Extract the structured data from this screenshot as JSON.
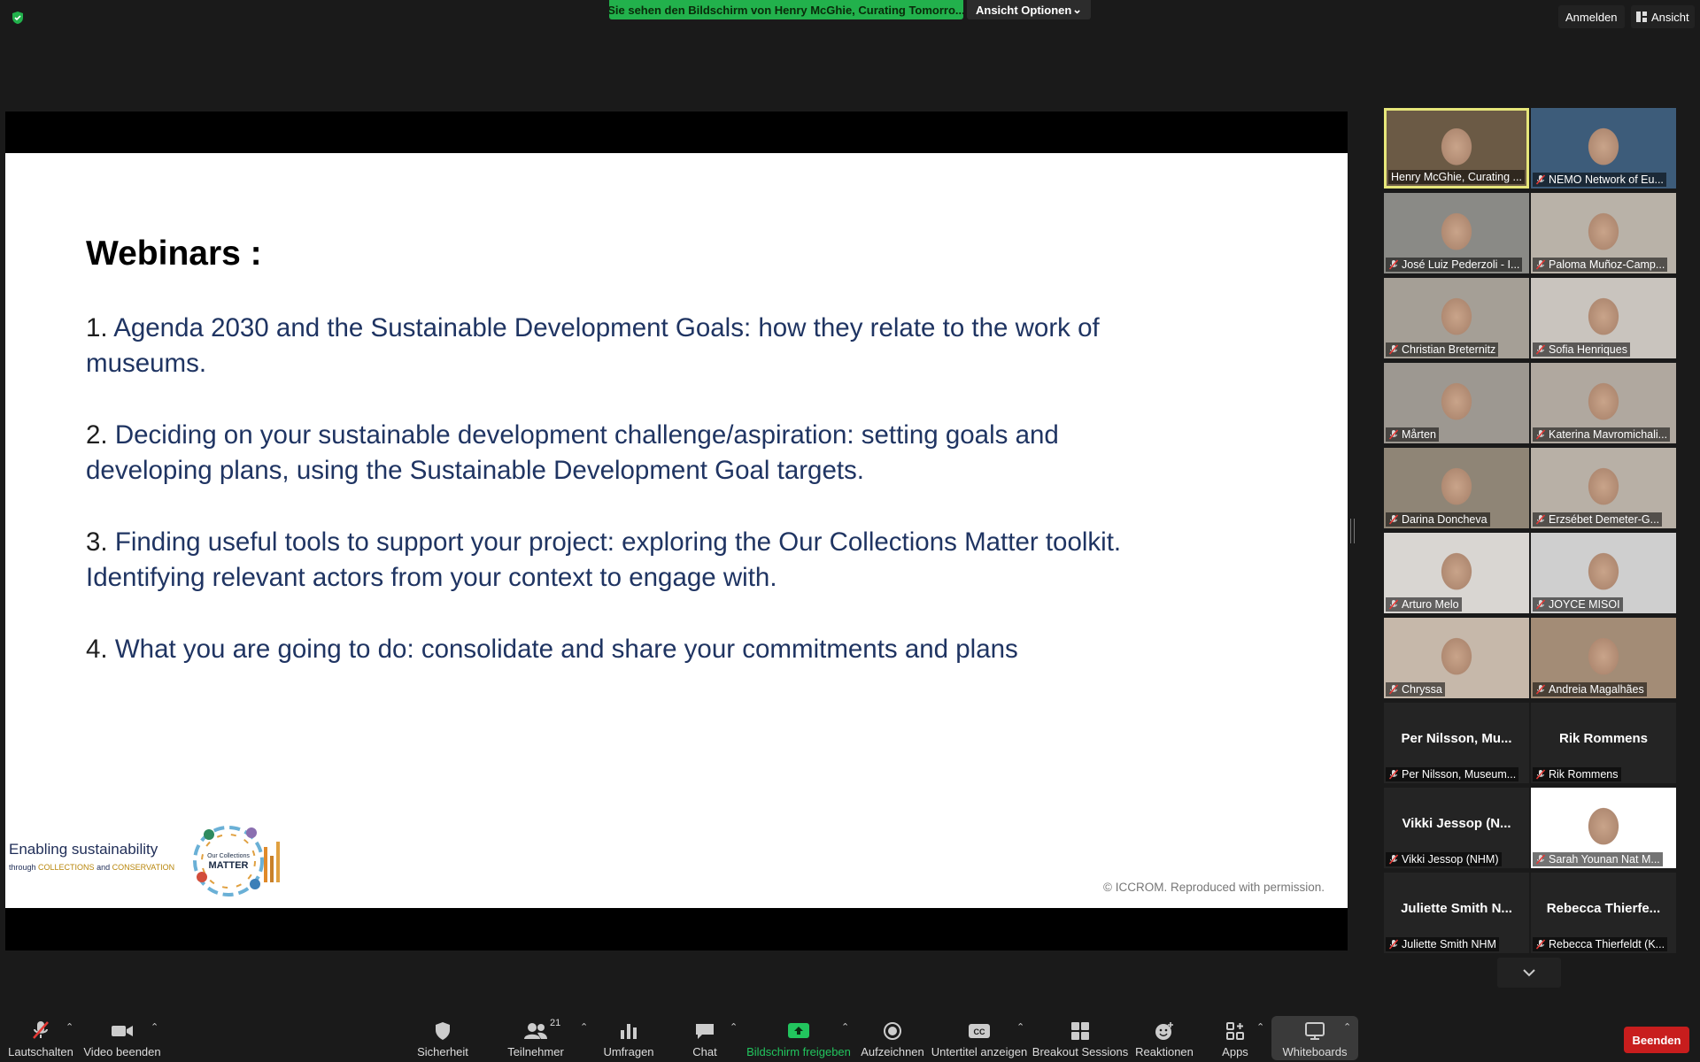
{
  "topbar": {
    "share_banner": "Sie sehen den Bildschirm von Henry McGhie, Curating Tomorro...",
    "view_options": "Ansicht Optionen",
    "sign_in": "Anmelden",
    "view": "Ansicht",
    "banner_color": "#22b14c"
  },
  "slide": {
    "heading": "Webinars :",
    "items": [
      {
        "num": "1.",
        "text": "Agenda 2030 and the Sustainable Development Goals: how they relate to the work of",
        "text2": "museums."
      },
      {
        "num": "2.",
        "text": "Deciding on your sustainable development challenge/aspiration: setting goals and",
        "text2": "developing plans, using the Sustainable Development Goal targets."
      },
      {
        "num": "3.",
        "text": "Finding useful tools to support your project: exploring the Our Collections Matter toolkit.",
        "text2": "Identifying relevant actors from your context to engage with."
      },
      {
        "num": "4.",
        "text": "What you are going to do: consolidate and share your commitments and plans",
        "text2": ""
      }
    ],
    "brand_title": "Enabling sustainability",
    "brand_through": "through",
    "brand_collections": "COLLECTIONS",
    "brand_and": "and",
    "brand_conservation": "CONSERVATION",
    "logo_line1": "Our Collections",
    "logo_line2": "MATTER",
    "copyright": "© ICCROM. Reproduced with permission."
  },
  "participants": [
    {
      "name": "Henry McGhie, Curating ...",
      "active": true,
      "muted": false,
      "bg": "#6b5a45"
    },
    {
      "name": "NEMO Network of Eu...",
      "muted": true,
      "bg": "#3d5c7a"
    },
    {
      "name": "José Luiz Pederzoli - I...",
      "muted": true,
      "bg": "#8a8a86"
    },
    {
      "name": "Paloma Muñoz-Camp...",
      "muted": true,
      "bg": "#b9b2a8"
    },
    {
      "name": "Christian Breternitz",
      "muted": true,
      "bg": "#a59f96"
    },
    {
      "name": "Sofia Henriques",
      "muted": true,
      "bg": "#c9c4be"
    },
    {
      "name": "Mårten",
      "muted": true,
      "bg": "#9d9891"
    },
    {
      "name": "Katerina Mavromichali...",
      "muted": true,
      "bg": "#b0a89f"
    },
    {
      "name": "Darina Doncheva",
      "muted": true,
      "bg": "#8f8576"
    },
    {
      "name": "Erzsébet  Demeter-G...",
      "muted": true,
      "bg": "#b8b0a6"
    },
    {
      "name": "Arturo Melo",
      "muted": true,
      "bg": "#d9d6d2"
    },
    {
      "name": "JOYCE MISOI",
      "muted": true,
      "bg": "#cfcfcf"
    },
    {
      "name": "Chryssa",
      "muted": true,
      "bg": "#c6b8aa"
    },
    {
      "name": "Andreia Magalhães",
      "muted": true,
      "bg": "#a38c76"
    },
    {
      "name": "Per Nilsson, Museum...",
      "title": "Per Nilsson, Mu...",
      "muted": true
    },
    {
      "name": "Rik Rommens",
      "title": "Rik Rommens",
      "muted": true
    },
    {
      "name": "Vikki Jessop (NHM)",
      "title": "Vikki Jessop (N...",
      "muted": true
    },
    {
      "name": "Sarah Younan Nat M...",
      "muted": true,
      "bg": "#ffffff"
    },
    {
      "name": "Juliette Smith NHM",
      "title": "Juliette Smith N...",
      "muted": true
    },
    {
      "name": "Rebecca Thierfeldt (K...",
      "title": "Rebecca  Thierfe...",
      "muted": true
    }
  ],
  "toolbar": {
    "mute": "Lautschalten",
    "video": "Video beenden",
    "security": "Sicherheit",
    "participants": "Teilnehmer",
    "participant_count": "21",
    "polls": "Umfragen",
    "chat": "Chat",
    "share": "Bildschirm freigeben",
    "record": "Aufzeichnen",
    "captions": "Untertitel anzeigen",
    "breakout": "Breakout Sessions",
    "reactions": "Reaktionen",
    "apps": "Apps",
    "whiteboards": "Whiteboards",
    "end": "Beenden"
  }
}
